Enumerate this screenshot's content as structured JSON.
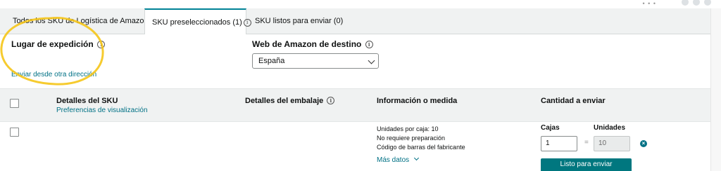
{
  "tabs": [
    {
      "label": "Todos los SKU de Logística de Amazon"
    },
    {
      "label": "SKU preseleccionados (1)",
      "active": true
    },
    {
      "label": "SKU listos para enviar (0)"
    }
  ],
  "shipping": {
    "origin_label": "Lugar de expedición",
    "origin_link": "Enviar desde otra dirección",
    "marketplace_label": "Web de Amazon de destino",
    "marketplace_value": "España"
  },
  "table": {
    "headers": {
      "sku": "Detalles del SKU",
      "sku_link": "Preferencias de visualización",
      "packing": "Detalles del embalaje",
      "info": "Información o medida",
      "quantity": "Cantidad a enviar"
    },
    "row": {
      "info_lines": [
        "Unidades por caja: 10",
        "No requiere preparación",
        "Código de barras del fabricante"
      ],
      "more_link": "Más datos",
      "boxes_label": "Cajas",
      "units_label": "Unidades",
      "boxes_value": "1",
      "equals": "=",
      "units_value": "10",
      "ready_button": "Listo para enviar"
    }
  },
  "colors": {
    "link": "#007185",
    "button": "#00777f",
    "highlight": "#f5c518"
  }
}
